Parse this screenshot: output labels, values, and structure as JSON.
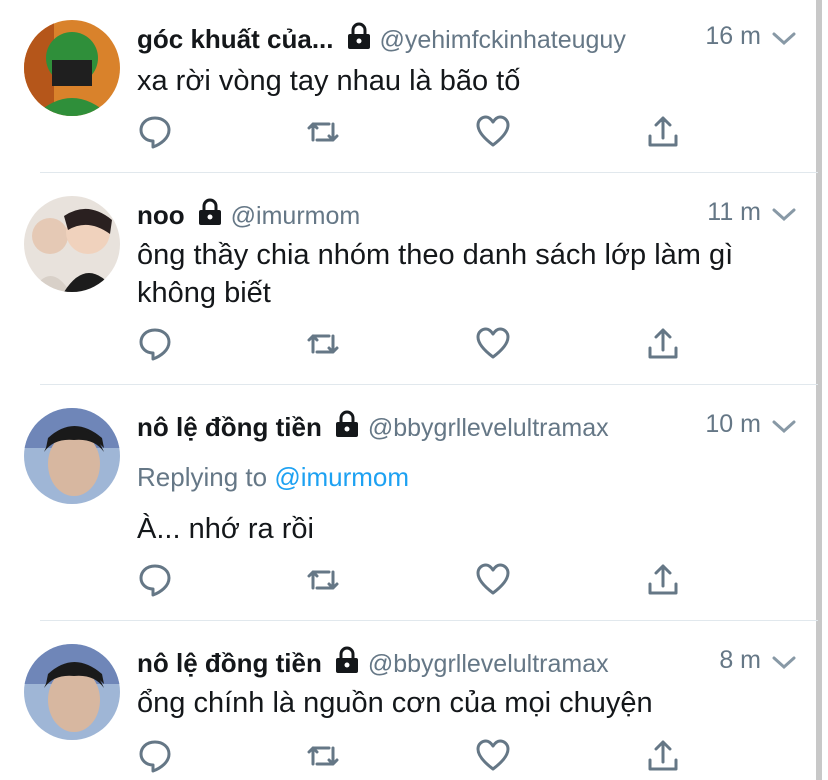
{
  "tweets": [
    {
      "name": "góc khuất của...",
      "handle": "@yehimfckinhateuguy",
      "time": "16 m",
      "text": "xa rời vòng tay nhau là bão tố",
      "reply_prefix": "",
      "reply_mention": ""
    },
    {
      "name": "noo",
      "handle": "@imurmom",
      "time": "11 m",
      "text": "ông thầy chia nhóm theo danh sách lớp làm gì không biết",
      "reply_prefix": "",
      "reply_mention": ""
    },
    {
      "name": "nô lệ đồng tiền",
      "handle": "@bbygrllevelultramax",
      "time": "10 m",
      "text": "À... nhớ ra rồi",
      "reply_prefix": "Replying to ",
      "reply_mention": "@imurmom"
    },
    {
      "name": "nô lệ đồng tiền",
      "handle": "@bbygrllevelultramax",
      "time": "8 m",
      "text": "ổng chính là nguồn cơn của mọi chuyện",
      "reply_prefix": "",
      "reply_mention": ""
    }
  ],
  "colors": {
    "text": "#14171a",
    "secondary": "#657786",
    "link": "#1da1f2",
    "divider": "#e1e8ed"
  },
  "icons": [
    "lock-icon",
    "chevron-down-icon",
    "reply-icon",
    "retweet-icon",
    "like-icon",
    "share-icon"
  ]
}
